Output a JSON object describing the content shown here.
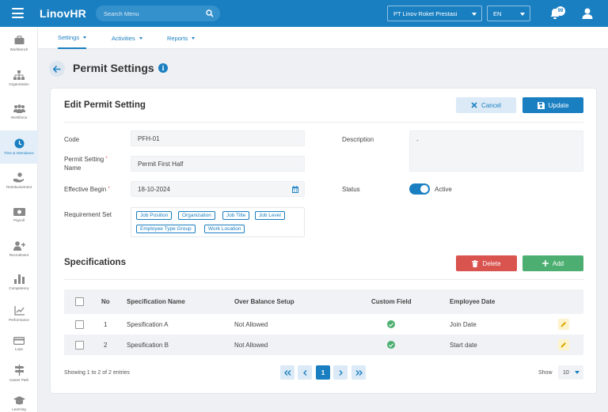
{
  "app": {
    "logo": "LinovHR",
    "search_placeholder": "Search Menu",
    "company": "PT Linov Roket Prestasi",
    "language": "EN",
    "notification_count": "99"
  },
  "subnav": [
    {
      "label": "Settings",
      "active": true
    },
    {
      "label": "Activities",
      "active": false
    },
    {
      "label": "Reports",
      "active": false
    }
  ],
  "sidebar": [
    {
      "label": "Workbench",
      "icon": "briefcase-icon"
    },
    {
      "label": "Organization",
      "icon": "org-chart-icon"
    },
    {
      "label": "Workforce",
      "icon": "people-icon"
    },
    {
      "label": "Time & Attendance",
      "icon": "clock-icon",
      "active": true
    },
    {
      "label": "Reimbursement",
      "icon": "hand-coin-icon"
    },
    {
      "label": "Payroll",
      "icon": "money-icon"
    },
    {
      "label": "Recruitment",
      "icon": "user-plus-icon"
    },
    {
      "label": "Competency",
      "icon": "bar-chart-icon"
    },
    {
      "label": "Performance",
      "icon": "line-chart-icon"
    },
    {
      "label": "Loan",
      "icon": "card-icon"
    },
    {
      "label": "Career Path",
      "icon": "signpost-icon"
    },
    {
      "label": "Learning",
      "icon": "graduation-cap-icon"
    }
  ],
  "page": {
    "title": "Permit Settings"
  },
  "form": {
    "title": "Edit Permit Setting",
    "cancel_label": "Cancel",
    "update_label": "Update",
    "code_label": "Code",
    "code_value": "PFH-01",
    "name_label_line1": "Permit Setting",
    "name_label_line2": "Name",
    "name_value": "Permit First Half",
    "effective_label": "Effective Begin",
    "effective_value": "18-10-2024",
    "requirement_label": "Requirement Set",
    "requirement_tags": [
      "Job Position",
      "Organization",
      "Job Title",
      "Job Level",
      "Employee Type Group",
      "Work Location"
    ],
    "description_label": "Description",
    "description_value": "-",
    "status_label": "Status",
    "status_value": "Active",
    "required_mark": "*"
  },
  "specifications": {
    "title": "Specifications",
    "delete_label": "Delete",
    "add_label": "Add",
    "columns": [
      "No",
      "Specification Name",
      "Over Balance Setup",
      "Custom Field",
      "Employee Date"
    ],
    "rows": [
      {
        "no": "1",
        "name": "Spesification A",
        "over_balance": "Not Allowed",
        "custom_field": true,
        "employee_date": "Join Date"
      },
      {
        "no": "2",
        "name": "Spesification B",
        "over_balance": "Not Allowed",
        "custom_field": true,
        "employee_date": "Start date"
      }
    ],
    "entries_text": "Showing 1 to 2 of 2 entries",
    "current_page": "1",
    "show_label": "Show",
    "page_size": "10"
  },
  "colors": {
    "primary": "#1a7fc1",
    "danger": "#d9534f",
    "success": "#4caf71"
  }
}
